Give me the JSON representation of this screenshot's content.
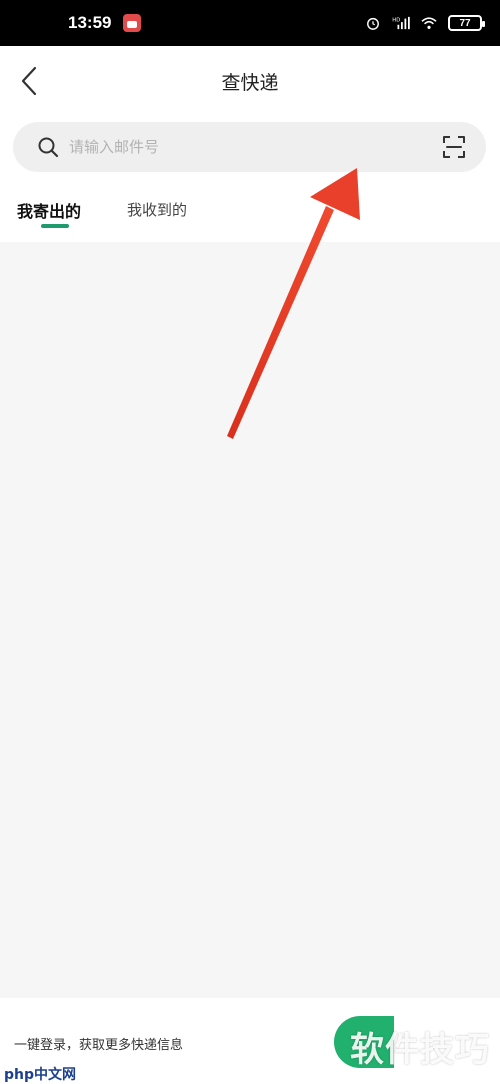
{
  "status_bar": {
    "time": "13:59",
    "battery": "77",
    "hd_label": "HD"
  },
  "header": {
    "title": "查快递",
    "back_icon": "chevron-left-icon"
  },
  "search": {
    "placeholder": "请输入邮件号",
    "search_icon": "search-icon",
    "scan_icon": "scan-icon"
  },
  "tabs": [
    {
      "label": "我寄出的",
      "active": true
    },
    {
      "label": "我收到的",
      "active": false
    }
  ],
  "banner": {
    "login_prompt": "一键登录，获取更多快递信息",
    "watermark": "软件技巧",
    "site_logo": "php中文网"
  },
  "colors": {
    "accent": "#1f9a6c",
    "button_green": "#22b06e",
    "arrow_red": "#e8402a"
  }
}
